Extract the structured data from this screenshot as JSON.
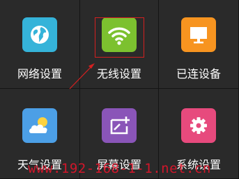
{
  "tiles": [
    {
      "label": "网络设置",
      "icon": "globe-icon",
      "color": "#35b3d9"
    },
    {
      "label": "无线设置",
      "icon": "wifi-icon",
      "color": "#7cc12f"
    },
    {
      "label": "已连设备",
      "icon": "monitor-icon",
      "color": "#f79420"
    },
    {
      "label": "天气设置",
      "icon": "weather-icon",
      "color": "#4c9fe6"
    },
    {
      "label": "屏幕设置",
      "icon": "screen-add-icon",
      "color": "#8a55b8"
    },
    {
      "label": "系统设置",
      "icon": "gear-icon",
      "color": "#e74a7d"
    }
  ],
  "watermark": "www.192-168-1-1.net.cn",
  "annotation_color": "#d42020"
}
